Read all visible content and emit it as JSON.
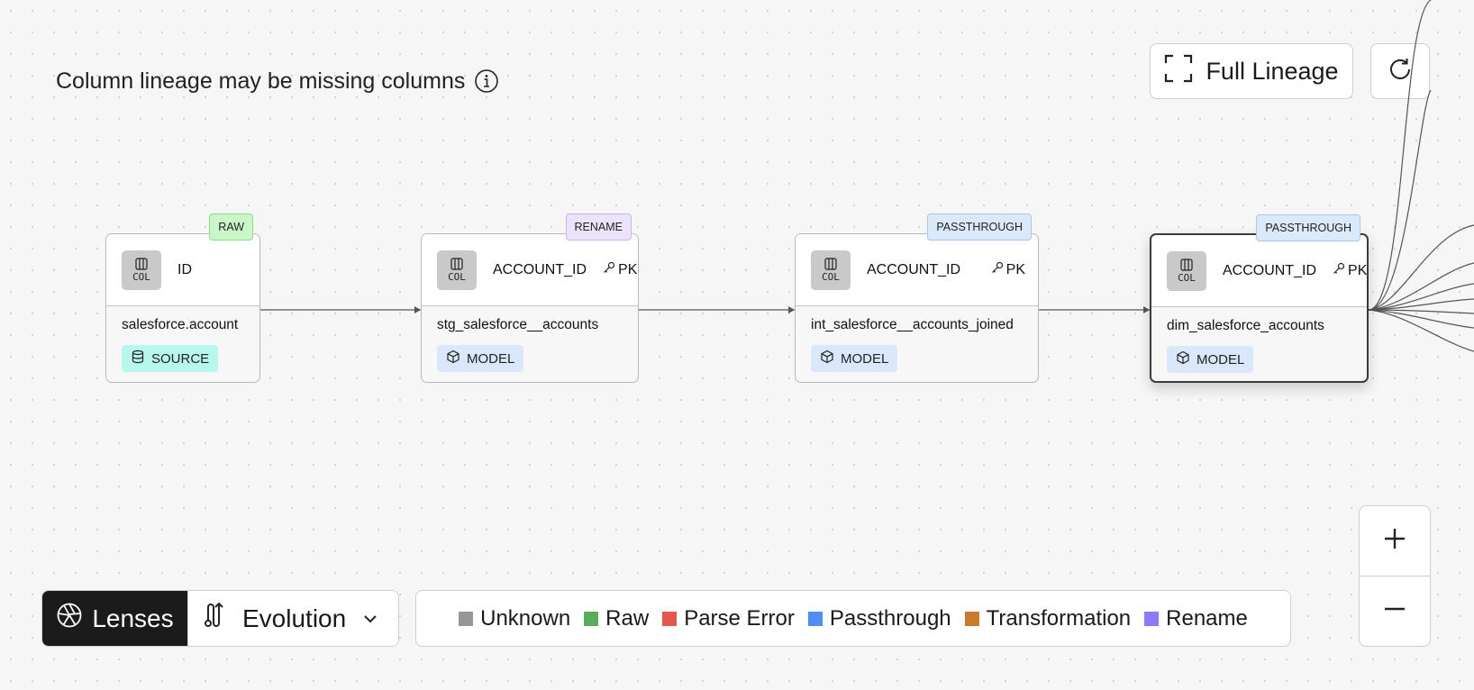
{
  "banner": {
    "text": "Column lineage may be missing columns",
    "icon": "info-icon"
  },
  "toolbar": {
    "full_lineage_label": "Full Lineage",
    "refresh_icon": "refresh-icon"
  },
  "nodes": [
    {
      "tag": "RAW",
      "tag_kind": "raw",
      "col_chip": "COL",
      "column": "ID",
      "pk": "",
      "model": "salesforce.account",
      "type": "SOURCE",
      "selected": false
    },
    {
      "tag": "RENAME",
      "tag_kind": "rename",
      "col_chip": "COL",
      "column": "ACCOUNT_ID",
      "pk": "PK",
      "model": "stg_salesforce__accounts",
      "type": "MODEL",
      "selected": false
    },
    {
      "tag": "PASSTHROUGH",
      "tag_kind": "pass",
      "col_chip": "COL",
      "column": "ACCOUNT_ID",
      "pk": "PK",
      "model": "int_salesforce__accounts_joined",
      "type": "MODEL",
      "selected": false
    },
    {
      "tag": "PASSTHROUGH",
      "tag_kind": "pass",
      "col_chip": "COL",
      "column": "ACCOUNT_ID",
      "pk": "PK",
      "model": "dim_salesforce_accounts",
      "type": "MODEL",
      "selected": true
    }
  ],
  "lenses": {
    "label": "Lenses",
    "selected_lens": "Evolution"
  },
  "legend": [
    {
      "label": "Unknown",
      "color": "#9b9696"
    },
    {
      "label": "Raw",
      "color": "#5aab5c"
    },
    {
      "label": "Parse Error",
      "color": "#e5564d"
    },
    {
      "label": "Passthrough",
      "color": "#4f8ff0"
    },
    {
      "label": "Transformation",
      "color": "#c97b2b"
    },
    {
      "label": "Rename",
      "color": "#8b7cf6"
    }
  ],
  "zoom": {
    "in_icon": "plus-icon",
    "out_icon": "minus-icon"
  }
}
